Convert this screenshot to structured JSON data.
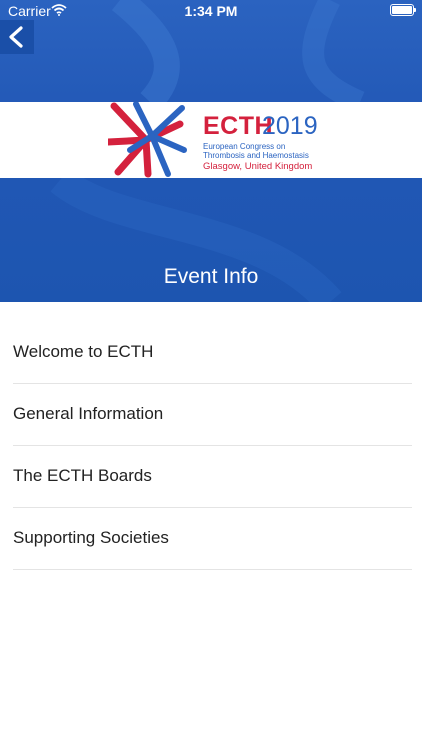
{
  "status_bar": {
    "carrier": "Carrier",
    "time": "1:34 PM"
  },
  "banner": {
    "ecth": "ECTH",
    "year": "2019",
    "congress_line1": "European Congress on",
    "congress_line2": "Thrombosis and Haemostasis",
    "location": "Glasgow, United Kingdom"
  },
  "page": {
    "title": "Event Info"
  },
  "menu": [
    {
      "label": "Welcome to ECTH"
    },
    {
      "label": "General Information"
    },
    {
      "label": "The ECTH Boards"
    },
    {
      "label": "Supporting Societies"
    }
  ],
  "colors": {
    "header_blue": "#2258b6",
    "brand_red": "#d4213d",
    "brand_blue": "#2b64c1"
  }
}
